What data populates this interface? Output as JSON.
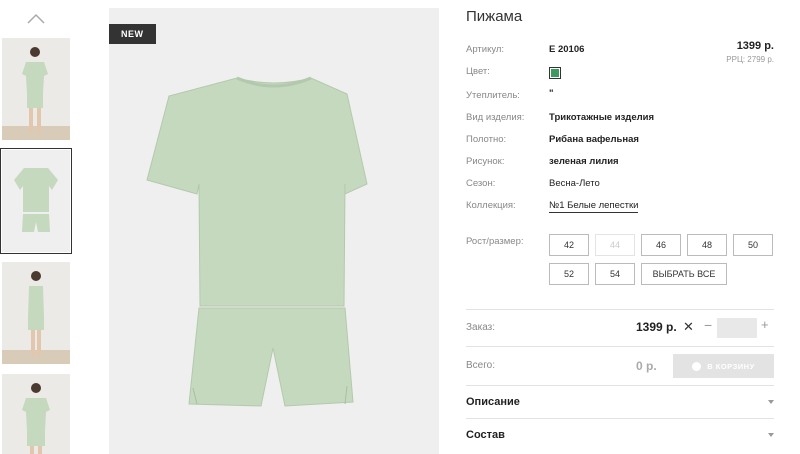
{
  "product": {
    "title": "Пижама",
    "badge": "NEW",
    "price": "1399 р.",
    "rrp": "РРЦ: 2799 р."
  },
  "attributes": [
    {
      "label": "Артикул:",
      "value": "Е 20106"
    },
    {
      "label": "Цвет:",
      "value": ""
    },
    {
      "label": "Утеплитель:",
      "value": "\""
    },
    {
      "label": "Вид изделия:",
      "value": "Трикотажные изделия"
    },
    {
      "label": "Полотно:",
      "value": "Рибана вафельная"
    },
    {
      "label": "Рисунок:",
      "value": "зеленая лилия"
    },
    {
      "label": "Сезон:",
      "value": "Весна-Лето"
    },
    {
      "label": "Коллекция:",
      "value": "№1 Белые лепестки"
    }
  ],
  "color_swatch": "#3c9a5f",
  "sizes": {
    "label": "Рост/размер:",
    "options": [
      {
        "label": "42",
        "available": true
      },
      {
        "label": "44",
        "available": false
      },
      {
        "label": "46",
        "available": true
      },
      {
        "label": "48",
        "available": true
      },
      {
        "label": "50",
        "available": true
      },
      {
        "label": "52",
        "available": true
      },
      {
        "label": "54",
        "available": true
      }
    ],
    "select_all": "ВЫБРАТЬ ВСЕ"
  },
  "order": {
    "label": "Заказ:",
    "price": "1399 р.",
    "qty_value": ""
  },
  "total": {
    "label": "Всего:",
    "value": "0 р.",
    "cart_button": "В КОРЗИНУ"
  },
  "accordions": [
    {
      "label": "Описание"
    },
    {
      "label": "Состав"
    }
  ],
  "garment_color": "#c4d9be"
}
